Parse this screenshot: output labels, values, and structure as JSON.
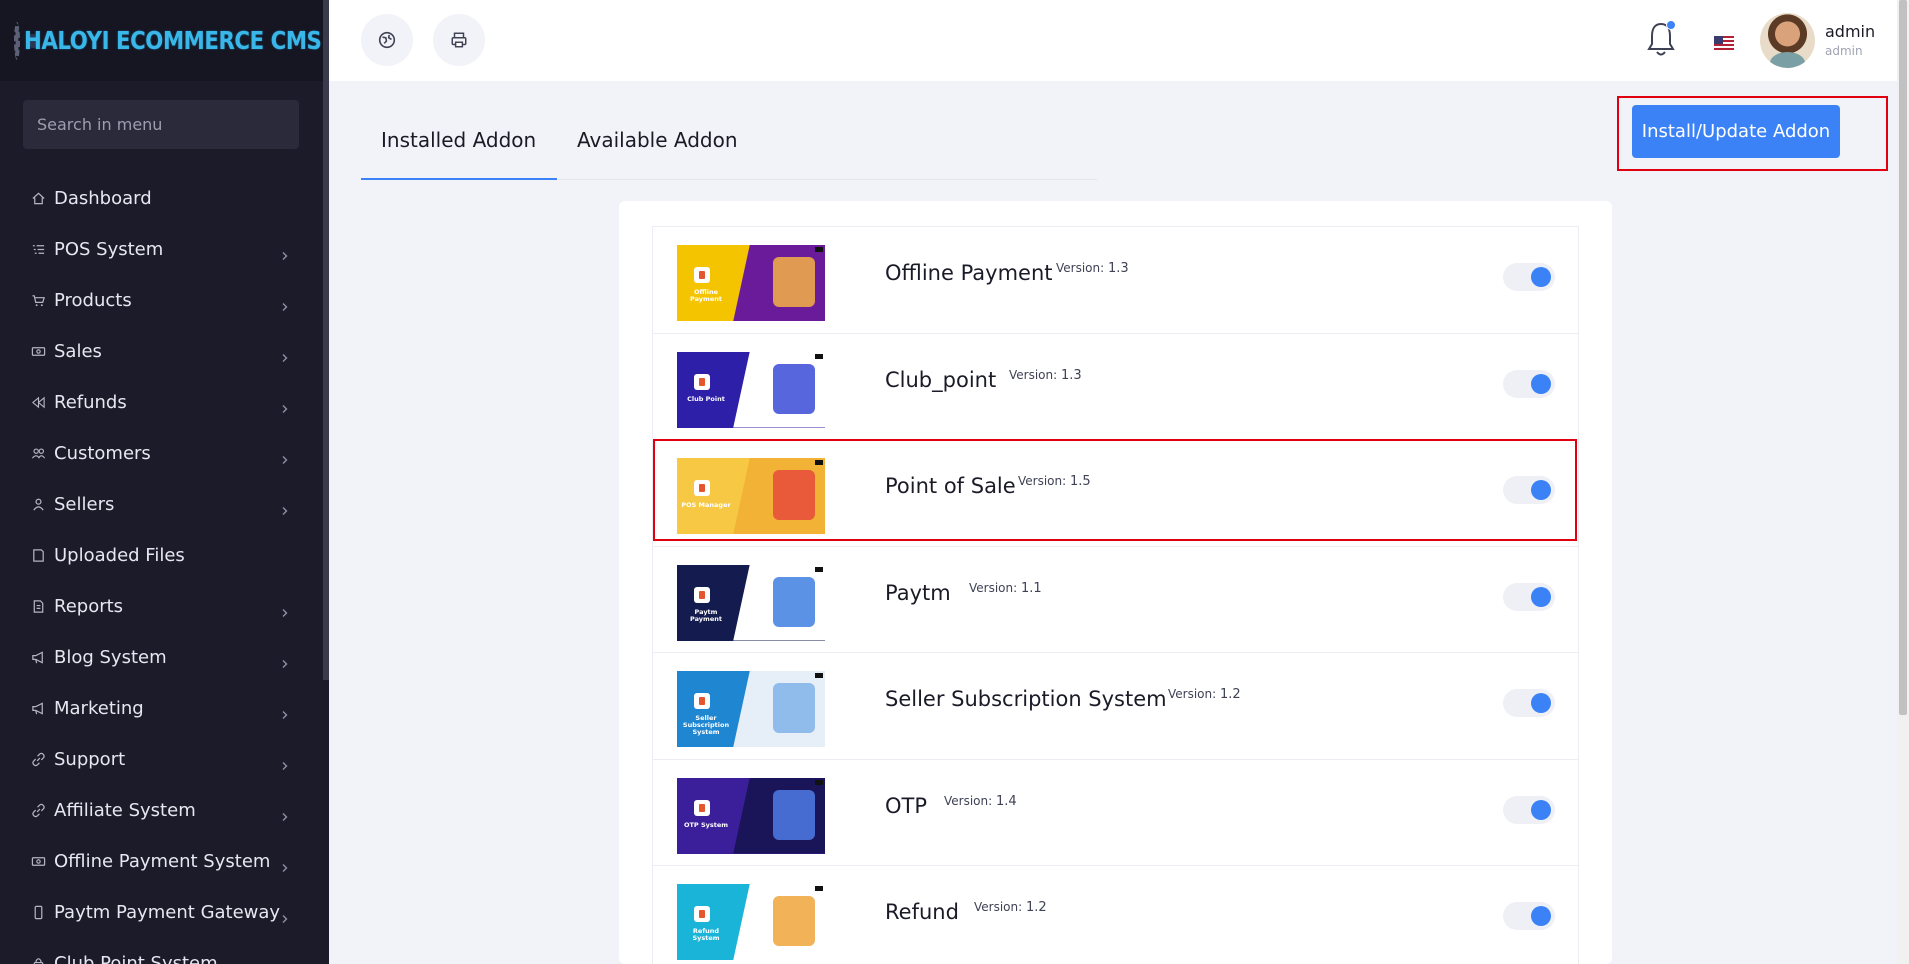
{
  "app": {
    "logo_text": "HALOYI ECOMMERCE CMS"
  },
  "sidebar": {
    "search_placeholder": "Search in menu",
    "items": [
      {
        "label": "Dashboard",
        "icon": "home-icon",
        "has_children": false
      },
      {
        "label": "POS System",
        "icon": "list-icon",
        "has_children": true
      },
      {
        "label": "Products",
        "icon": "cart-icon",
        "has_children": true
      },
      {
        "label": "Sales",
        "icon": "money-icon",
        "has_children": true
      },
      {
        "label": "Refunds",
        "icon": "backward-icon",
        "has_children": true
      },
      {
        "label": "Customers",
        "icon": "users-icon",
        "has_children": true
      },
      {
        "label": "Sellers",
        "icon": "user-icon",
        "has_children": true
      },
      {
        "label": "Uploaded Files",
        "icon": "folder-icon",
        "has_children": false
      },
      {
        "label": "Reports",
        "icon": "file-icon",
        "has_children": true
      },
      {
        "label": "Blog System",
        "icon": "bullhorn-icon",
        "has_children": true
      },
      {
        "label": "Marketing",
        "icon": "bullhorn-icon",
        "has_children": true
      },
      {
        "label": "Support",
        "icon": "link-icon",
        "has_children": true
      },
      {
        "label": "Affiliate System",
        "icon": "link-icon",
        "has_children": true
      },
      {
        "label": "Offline Payment System",
        "icon": "money-icon",
        "has_children": true
      },
      {
        "label": "Paytm Payment Gateway",
        "icon": "mobile-icon",
        "has_children": true
      },
      {
        "label": "Club Point System",
        "icon": "lock-icon",
        "has_children": true
      }
    ]
  },
  "header": {
    "user_name": "admin",
    "user_role": "admin",
    "language_flag": "us-flag-icon"
  },
  "tabs": [
    {
      "label": "Installed Addon",
      "active": true
    },
    {
      "label": "Available Addon",
      "active": false
    }
  ],
  "install_button_label": "Install/Update Addon",
  "addons": [
    {
      "name": "Offline Payment",
      "version_label": "Version:",
      "version": "1.3",
      "enabled": true,
      "thumb_caption": "Offline Payment",
      "thumb_left": "#f5c400",
      "thumb_right": "#6a1b9a",
      "art": "#f6b044"
    },
    {
      "name": "Club_point",
      "version_label": "Version:",
      "version": "1.3",
      "enabled": true,
      "thumb_caption": "Club Point",
      "thumb_left": "#2e1fa8",
      "thumb_right": "#ffffff",
      "art": "#3b4bd8"
    },
    {
      "name": "Point of Sale",
      "version_label": "Version:",
      "version": "1.5",
      "enabled": true,
      "thumb_caption": "POS Manager",
      "thumb_left": "#f7c843",
      "thumb_right": "#f2b236",
      "art": "#e84a3c"
    },
    {
      "name": "Paytm",
      "version_label": "Version:",
      "version": "1.1",
      "enabled": true,
      "thumb_caption": "Paytm Payment",
      "thumb_left": "#131b4f",
      "thumb_right": "#ffffff",
      "art": "#3f7fe0"
    },
    {
      "name": "Seller Subscription System",
      "version_label": "Version:",
      "version": "1.2",
      "enabled": true,
      "thumb_caption": "Seller Subscription System",
      "thumb_left": "#1f86d1",
      "thumb_right": "#e6eef8",
      "art": "#7fb3e8"
    },
    {
      "name": "OTP",
      "version_label": "Version:",
      "version": "1.4",
      "enabled": true,
      "thumb_caption": "OTP System",
      "thumb_left": "#3a1e9a",
      "thumb_right": "#1a1458",
      "art": "#4f7be8"
    },
    {
      "name": "Refund",
      "version_label": "Version:",
      "version": "1.2",
      "enabled": true,
      "thumb_caption": "Refund System",
      "thumb_left": "#19b4d8",
      "thumb_right": "#ffffff",
      "art": "#f0a43a"
    }
  ]
}
